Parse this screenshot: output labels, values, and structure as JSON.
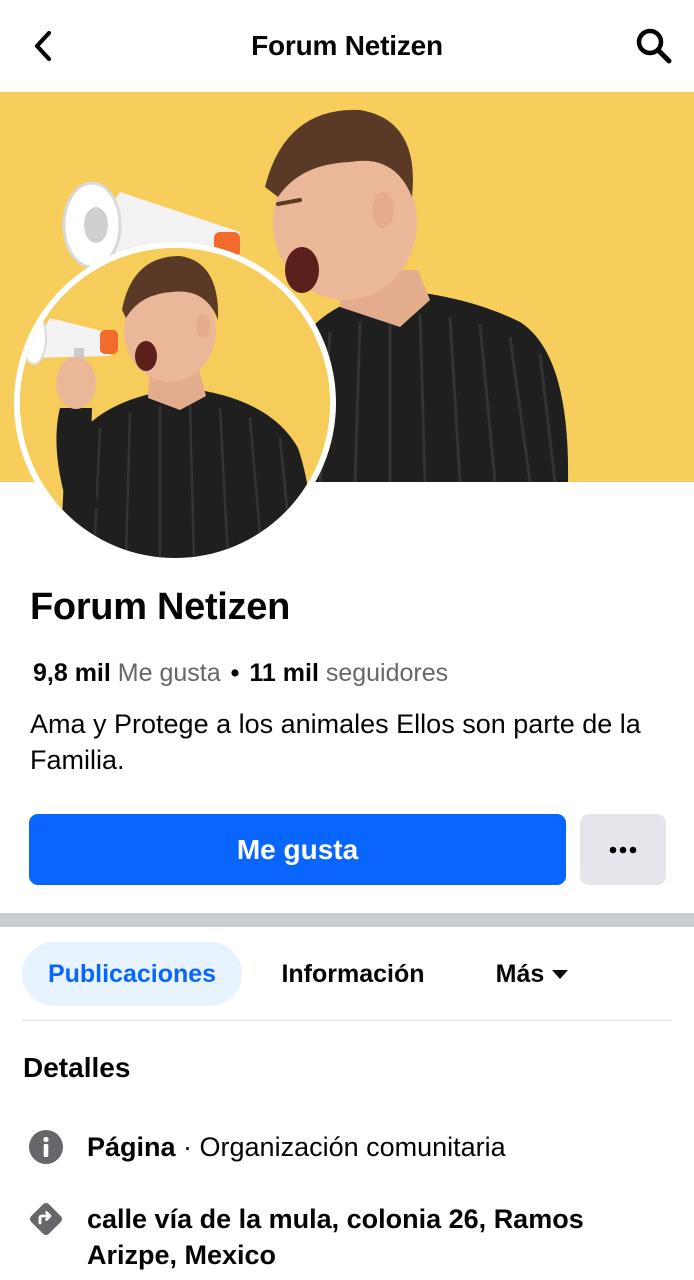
{
  "header": {
    "title": "Forum Netizen"
  },
  "profile": {
    "name": "Forum Netizen",
    "likes_count": "9,8 mil",
    "likes_label": "Me gusta",
    "separator": "•",
    "followers_count": "11 mil",
    "followers_label": "seguidores",
    "bio": "Ama y Protege a los animales  Ellos son parte de la Familia."
  },
  "actions": {
    "like_label": "Me gusta",
    "more_label": "•••",
    "like_color": "#0866ff"
  },
  "tabs": [
    {
      "label": "Publicaciones",
      "active": true
    },
    {
      "label": "Información",
      "active": false
    },
    {
      "label": "Más",
      "active": false
    }
  ],
  "details": {
    "title": "Detalles",
    "items": [
      {
        "icon": "info-icon",
        "bold": "Página",
        "text": " · Organización comunitaria"
      },
      {
        "icon": "directions-icon",
        "bold": "calle vía de la mula, colonia 26, Ramos Arizpe, Mexico",
        "text": ""
      }
    ]
  },
  "colors": {
    "cover_background": "#f7cd5b",
    "accent": "#0866ff",
    "active_tab_bg": "#e7f3ff"
  }
}
